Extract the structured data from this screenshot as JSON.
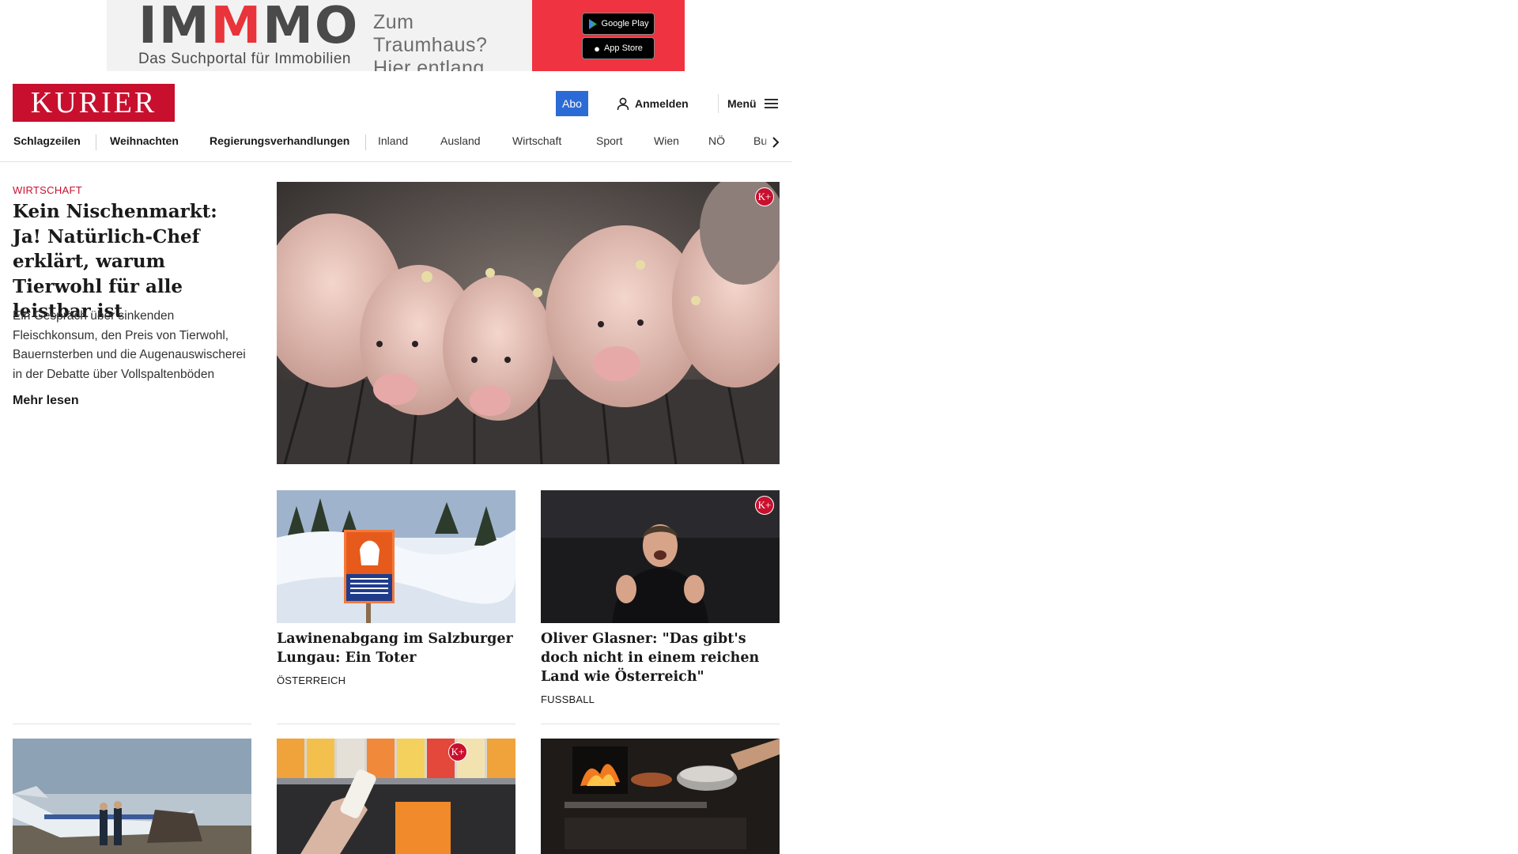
{
  "ad": {
    "brand": "IMMMO",
    "tagline": "Das Suchportal für Immobilien",
    "claim_line1": "Zum Traumhaus?",
    "claim_line2": "Hier entlang.",
    "google_play": "Google Play",
    "app_store": "App Store",
    "accent": "#ef3340"
  },
  "header": {
    "logo": "KURIER",
    "abo": "Abo",
    "login": "Anmelden",
    "menu": "Menü",
    "brand_color": "#c8102e"
  },
  "nav": {
    "items": [
      "Schlagzeilen",
      "Weihnachten",
      "Regierungsverhandlungen",
      "Inland",
      "Ausland",
      "Wirtschaft",
      "Sport",
      "Wien",
      "NÖ",
      "Bu"
    ]
  },
  "lead": {
    "category": "Wirtschaft",
    "title": "Kein Nischenmarkt: Ja! Natürlich-Chef erklärt, warum Tierwohl für alle leistbar ist",
    "text": "Ein Gespräch über sinkenden Fleischkonsum, den Preis von Tierwohl, Bauernsterben und die Augenauswischerei in der Debatte über Vollspaltenböden",
    "more": "Mehr lesen",
    "badge": "K+"
  },
  "cards": [
    {
      "title": "Lawinenabgang im Salzburger Lungau: Ein Toter",
      "category": "Österreich",
      "sign_text": "LAWINENGEFAHR DANGER D'AVALANCHES DANGER OF AVALANCHES PERICOLO DI VALANGHE"
    },
    {
      "title": "Oliver Glasner: \"Das gibt's doch nicht in einem reichen Land wie Österreich\"",
      "category": "Fussball",
      "badge": "K+"
    }
  ],
  "bottom_row": [
    {
      "image": "plane-crash"
    },
    {
      "image": "supermarket-shelf",
      "badge": "K+"
    },
    {
      "image": "wood-oven-cooking"
    }
  ]
}
